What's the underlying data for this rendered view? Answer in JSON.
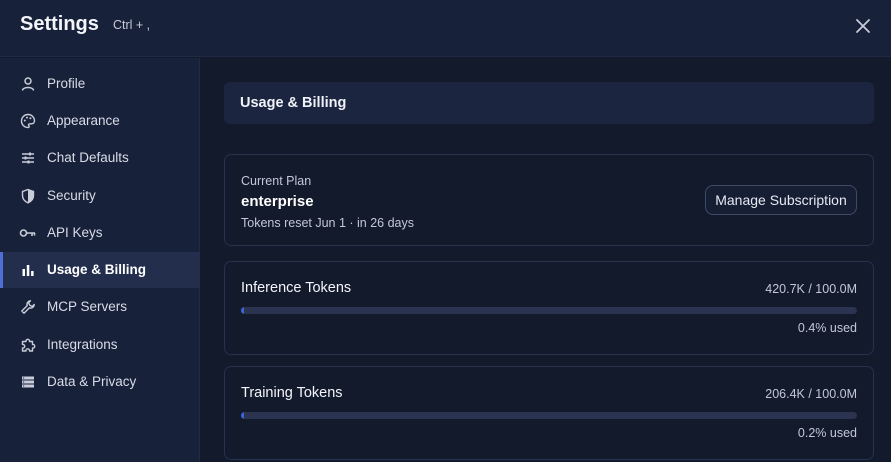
{
  "header": {
    "title": "Settings",
    "shortcut": "Ctrl + ,"
  },
  "sidebar": {
    "items": [
      {
        "label": "Profile",
        "icon": "person-icon"
      },
      {
        "label": "Appearance",
        "icon": "palette-icon"
      },
      {
        "label": "Chat Defaults",
        "icon": "sliders-icon"
      },
      {
        "label": "Security",
        "icon": "shield-icon"
      },
      {
        "label": "API Keys",
        "icon": "key-icon"
      },
      {
        "label": "Usage & Billing",
        "icon": "bar-chart-icon",
        "active": true
      },
      {
        "label": "MCP Servers",
        "icon": "wrench-icon"
      },
      {
        "label": "Integrations",
        "icon": "puzzle-icon"
      },
      {
        "label": "Data & Privacy",
        "icon": "storage-icon"
      }
    ]
  },
  "main": {
    "section_title": "Usage & Billing",
    "plan": {
      "label": "Current Plan",
      "name": "enterprise",
      "reset": "Tokens reset Jun 1 · in 26 days",
      "manage_label": "Manage Subscription"
    },
    "usage": [
      {
        "title": "Inference Tokens",
        "count": "420.7K / 100.0M",
        "used": "0.4% used",
        "fraction": 0.004
      },
      {
        "title": "Training Tokens",
        "count": "206.4K / 100.0M",
        "used": "0.2% used",
        "fraction": 0.002
      }
    ]
  },
  "colors": {
    "accent": "#3d63d9",
    "active_indicator": "#4f6fd8"
  }
}
